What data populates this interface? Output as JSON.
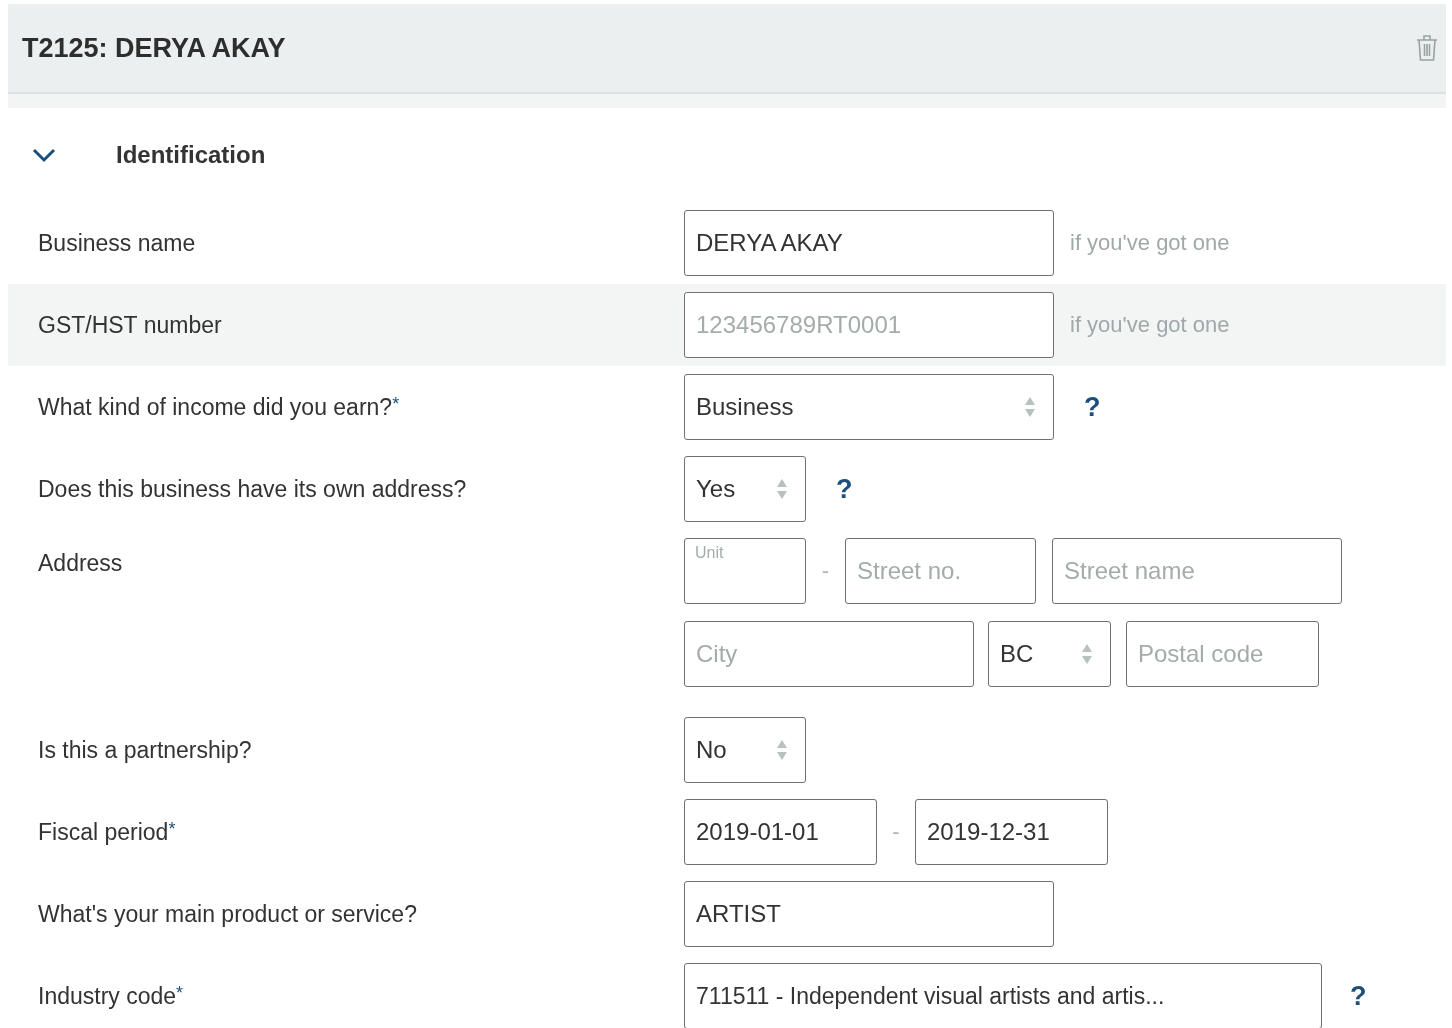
{
  "header": {
    "title": "T2125: DERYA AKAY"
  },
  "section": {
    "title": "Identification",
    "expanded": true
  },
  "rows": [
    {
      "kind": "text",
      "label": "Business name",
      "value": "DERYA AKAY",
      "hint": "if you've got one",
      "highlighted": false
    },
    {
      "kind": "text",
      "label": "GST/HST number",
      "placeholder": "123456789RT0001",
      "hint": "if you've got one",
      "highlighted": true
    },
    {
      "kind": "select",
      "label": "What kind of income did you earn?",
      "required_mark": "*",
      "value": "Business",
      "help": "?",
      "highlighted": false
    },
    {
      "kind": "toggle",
      "label": "Does this business have its own address?",
      "value": "Yes",
      "help": "?",
      "highlighted": false
    },
    {
      "kind": "address",
      "label": "Address",
      "unit": {
        "placeholder": "Unit"
      },
      "separator": "-",
      "street_no": {
        "placeholder": "Street no."
      },
      "street_name": {
        "placeholder": "Street name"
      },
      "city": {
        "placeholder": "City"
      },
      "province": {
        "value": "BC"
      },
      "postal_code": {
        "placeholder": "Postal code"
      },
      "highlighted": false
    },
    {
      "kind": "toggle",
      "label": "Is this a partnership?",
      "value": "No",
      "highlighted": false
    },
    {
      "kind": "dates",
      "label": "Fiscal period",
      "required_mark": "*",
      "start": "2019-01-01",
      "separator": "-",
      "end": "2019-12-31",
      "highlighted": false
    },
    {
      "kind": "text",
      "label": "What's your main product or service?",
      "value": "ARTIST",
      "highlighted": false
    },
    {
      "kind": "code",
      "label": "Industry code",
      "required_mark": "*",
      "value": "711511 - Independent visual artists and artis...",
      "help": "?",
      "highlighted": false
    }
  ]
}
